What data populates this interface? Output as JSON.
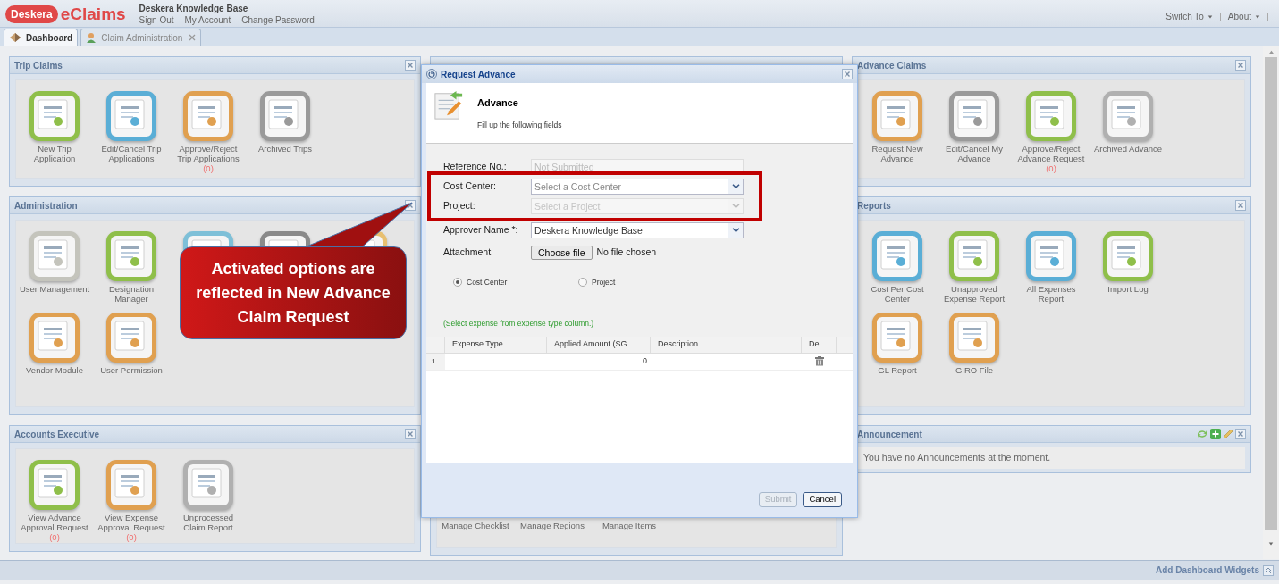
{
  "header": {
    "logo_text": "Deskera",
    "app_name": "eClaims",
    "company": "Deskera Knowledge Base",
    "links": [
      "Sign Out",
      "My Account",
      "Change Password"
    ],
    "menus": [
      "Switch To",
      "About"
    ]
  },
  "tabs": [
    {
      "label": "Dashboard",
      "selected": true,
      "closable": false
    },
    {
      "label": "Claim Administration",
      "selected": false,
      "closable": true
    }
  ],
  "columns": [
    {
      "panels": [
        {
          "title": "Trip Claims",
          "kind": "tiles",
          "rows": [
            [
              {
                "label": "New Trip Application",
                "color": "#8fbf4a"
              },
              {
                "label": "Edit/Cancel Trip Applications",
                "color": "#5aaed6"
              },
              {
                "label": "Approve/Reject Trip Applications",
                "count": "(0)",
                "color": "#e0a050"
              },
              {
                "label": "Archived Trips",
                "color": "#9a9a9a"
              }
            ]
          ]
        },
        {
          "title": "Administration",
          "kind": "tiles",
          "rows": [
            [
              {
                "label": "User Management",
                "color": "#c4c4bc"
              },
              {
                "label": "Designation Manager",
                "color": "#8fbf4a"
              },
              {
                "color": "#7ec0d8"
              },
              {
                "color": "#8a8a8a"
              },
              {
                "color": "#e8c070"
              }
            ],
            [
              {
                "label": "Vendor Module",
                "color": "#e0a050"
              },
              {
                "label": "User Permission",
                "color": "#e0a050"
              }
            ]
          ]
        },
        {
          "title": "Accounts Executive",
          "kind": "tiles",
          "rows": [
            [
              {
                "label": "View Advance Approval Request",
                "count": "(0)",
                "color": "#8fbf4a"
              },
              {
                "label": "View Expense Approval Request",
                "count": "(0)",
                "color": "#e0a050"
              },
              {
                "label": "Unprocessed Claim Report",
                "color": "#b0b0b0"
              }
            ]
          ]
        }
      ]
    },
    {
      "panels": [
        {
          "kind": "tiles",
          "rows": [
            [
              {
                "label": "Manage Checklist"
              },
              {
                "label": "Manage Regions"
              },
              {
                "label": "Manage Items"
              }
            ]
          ]
        }
      ]
    },
    {
      "panels": [
        {
          "title": "Advance Claims",
          "kind": "tiles",
          "rows": [
            [
              {
                "label": "Request New Advance",
                "color": "#e0a050"
              },
              {
                "label": "Edit/Cancel My Advance",
                "color": "#9a9a9a"
              },
              {
                "label": "Approve/Reject Advance Request",
                "count": "(0)",
                "color": "#8fbf4a"
              },
              {
                "label": "Archived Advance",
                "color": "#b0b0b0"
              }
            ]
          ]
        },
        {
          "title": "Reports",
          "kind": "tiles",
          "rows": [
            [
              {
                "label": "Cost Per Cost Center",
                "color": "#5aaed6"
              },
              {
                "label": "Unapproved Expense Report",
                "color": "#8fbf4a"
              },
              {
                "label": "All Expenses Report",
                "color": "#5aaed6"
              },
              {
                "label": "Import Log",
                "color": "#8fbf4a"
              }
            ],
            [
              {
                "label": "GL Report",
                "color": "#e0a050"
              },
              {
                "label": "GIRO File",
                "color": "#e0a050"
              }
            ]
          ]
        },
        {
          "title": "Announcement",
          "kind": "message",
          "message": "You have no Announcements at the moment."
        }
      ]
    }
  ],
  "dialog": {
    "title": "Request Advance",
    "heading": "Advance",
    "subheading": "Fill up the following fields",
    "fields": [
      {
        "kind": "text",
        "label": "Reference No.:",
        "value": "Not Submitted",
        "disabled": true
      },
      {
        "kind": "combo",
        "label": "Cost Center:",
        "placeholder": "Select a Cost Center",
        "disabled": false
      },
      {
        "kind": "combo",
        "label": "Project:",
        "placeholder": "Select a Project",
        "disabled": true
      },
      {
        "kind": "combo",
        "label": "Approver Name *:",
        "value": "Deskera Knowledge Base",
        "disabled": false
      },
      {
        "kind": "file",
        "label": "Attachment:",
        "button": "Choose file",
        "status": "No file chosen"
      }
    ],
    "radios": [
      {
        "label": "Cost Center",
        "selected": true
      },
      {
        "label": "Project",
        "selected": false
      }
    ],
    "hint": "(Select expense from expense type column.)",
    "grid": {
      "columns": [
        "Expense Type",
        "Applied Amount (SG...",
        "Description",
        "Del..."
      ],
      "rows": [
        {
          "number": "1",
          "amount": "0"
        }
      ]
    },
    "buttons": [
      {
        "label": "Submit",
        "disabled": true
      },
      {
        "label": "Cancel",
        "disabled": false
      }
    ]
  },
  "callout": {
    "text": "Activated options are reflected in New Advance Claim Request"
  },
  "footer": {
    "label": "Add Dashboard Widgets"
  }
}
